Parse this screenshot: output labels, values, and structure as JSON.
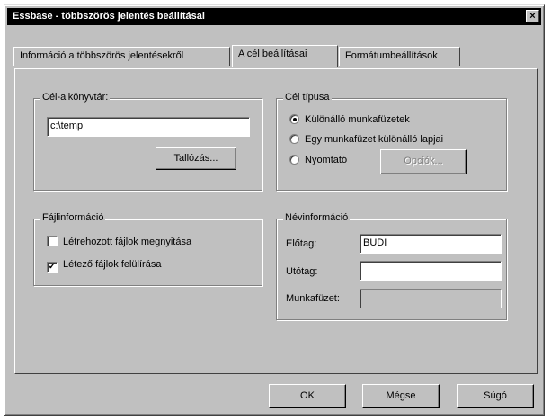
{
  "window": {
    "title": "Essbase - többszörös jelentés beállításai",
    "close_symbol": "×"
  },
  "tabs": [
    {
      "label": "Információ a többszörös jelentésekről",
      "active": false
    },
    {
      "label": "A cél beállításai",
      "active": true
    },
    {
      "label": "Formátumbeállítások",
      "active": false
    }
  ],
  "target_directory": {
    "legend": "Cél-alkönyvtár:",
    "value": "c:\\temp",
    "browse_label": "Tallózás..."
  },
  "target_type": {
    "legend": "Cél típusa",
    "options": [
      {
        "label": "Különálló munkafüzetek",
        "selected": true
      },
      {
        "label": "Egy munkafüzet különálló lapjai",
        "selected": false
      },
      {
        "label": "Nyomtató",
        "selected": false
      }
    ],
    "options_button_label": "Opciók..."
  },
  "file_info": {
    "legend": "Fájlinformáció",
    "checkboxes": [
      {
        "label": "Létrehozott fájlok megnyitása",
        "checked": false
      },
      {
        "label": "Létező fájlok felülírása",
        "checked": true
      }
    ],
    "check_mark": "✓"
  },
  "name_info": {
    "legend": "Névinformáció",
    "prefix_label": "Előtag:",
    "prefix_value": "BUDI",
    "suffix_label": "Utótag:",
    "suffix_value": "",
    "workbook_label": "Munkafüzet:",
    "workbook_value": ""
  },
  "footer": {
    "ok_label": "OK",
    "cancel_label": "Mégse",
    "help_label": "Súgó"
  }
}
